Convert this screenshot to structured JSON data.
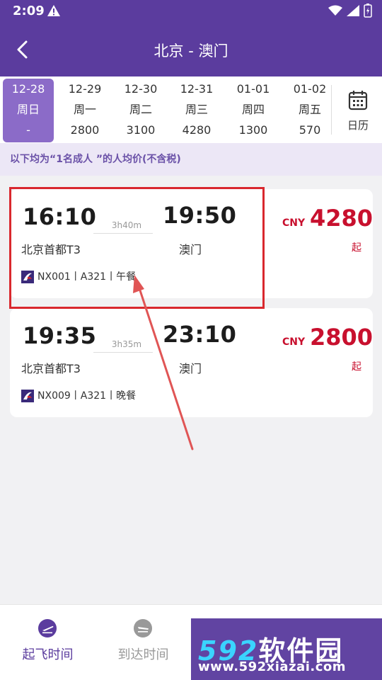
{
  "status": {
    "time": "2:09"
  },
  "header": {
    "title": "北京 - 澳门"
  },
  "dates": [
    {
      "date": "12-28",
      "weekday": "周日",
      "price": "-",
      "active": true
    },
    {
      "date": "12-29",
      "weekday": "周一",
      "price": "2800"
    },
    {
      "date": "12-30",
      "weekday": "周二",
      "price": "3100"
    },
    {
      "date": "12-31",
      "weekday": "周三",
      "price": "4280"
    },
    {
      "date": "01-01",
      "weekday": "周四",
      "price": "1300"
    },
    {
      "date": "01-02",
      "weekday": "周五",
      "price": "570"
    }
  ],
  "calendar": {
    "label": "日历"
  },
  "notice": "以下均为“1名成人 ”的人均价(不含税)",
  "flights": [
    {
      "dep_time": "16:10",
      "arr_time": "19:50",
      "duration": "3h40m",
      "dep_airport": "北京首都T3",
      "arr_airport": "澳门",
      "currency": "CNY",
      "price": "4280",
      "price_suffix": "起",
      "info": "NX001丨A321丨午餐"
    },
    {
      "dep_time": "19:35",
      "arr_time": "23:10",
      "duration": "3h35m",
      "dep_airport": "北京首都T3",
      "arr_airport": "澳门",
      "currency": "CNY",
      "price": "2800",
      "price_suffix": "起",
      "info": "NX009丨A321丨晚餐"
    }
  ],
  "bottom_tabs": [
    {
      "label": "起飞时间",
      "active": true
    },
    {
      "label": "到达时间",
      "active": false
    }
  ],
  "watermark": {
    "brand_num": "592",
    "brand_text": "软件园",
    "url": "www.592xiazai.com"
  },
  "colors": {
    "primary": "#5b3c9e",
    "active_date": "#8b6bc8",
    "price": "#c8102e",
    "annotation": "#d9282e"
  }
}
